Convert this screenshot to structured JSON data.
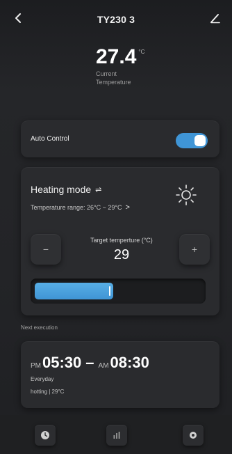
{
  "header": {
    "title": "TY230 3",
    "back_icon": "chevron-left-icon",
    "edit_icon": "pencil-icon"
  },
  "current": {
    "value": "27.4",
    "unit": "°C",
    "label": "Current Temperature"
  },
  "auto_control": {
    "label": "Auto Control",
    "enabled": true
  },
  "mode": {
    "title": "Heating mode",
    "swap_glyph": "⇌",
    "range_text": "Temperature range:  26°C ~ 29°C",
    "range_chevron": ">",
    "mode_icon": "sun-icon"
  },
  "target": {
    "label": "Target temperture  (°C)",
    "value": "29",
    "minus_label": "−",
    "plus_label": "+",
    "slider_fraction": 0.47
  },
  "schedule": {
    "section_label": "Next execution",
    "start_ampm": "PM",
    "start_time": "05:30",
    "separator": "–",
    "end_ampm": "AM",
    "end_time": "08:30",
    "repeat": "Everyday",
    "detail": "hotting | 29°C"
  },
  "bottom_nav": [
    {
      "icon": "clock-icon"
    },
    {
      "icon": "bar-chart-icon"
    },
    {
      "icon": "settings-icon"
    }
  ],
  "colors": {
    "accent": "#3f95d6",
    "background": "#232427",
    "card": "#2a2b2e"
  }
}
